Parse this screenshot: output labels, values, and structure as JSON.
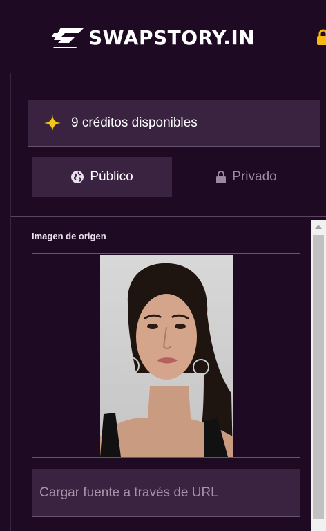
{
  "header": {
    "brand": "SWAPSTORY.IN",
    "logo_icon": "swapstory-logo-mark",
    "corner_icon": "lock-icon",
    "accent_color": "#f5b90f"
  },
  "credits": {
    "icon": "sparkle-star-icon",
    "text": "9 créditos disponibles"
  },
  "visibility_toggle": {
    "options": [
      {
        "label": "Público",
        "icon": "globe-icon",
        "selected": true
      },
      {
        "label": "Privado",
        "icon": "lock-icon",
        "selected": false
      }
    ]
  },
  "source_image": {
    "label": "Imagen de origen"
  },
  "url_input": {
    "placeholder": "Cargar fuente a través de URL",
    "value": ""
  },
  "colors": {
    "background": "#1f0a24",
    "panel": "#3a2241",
    "border": "#6a5370",
    "text_muted": "#9a8aa0"
  }
}
